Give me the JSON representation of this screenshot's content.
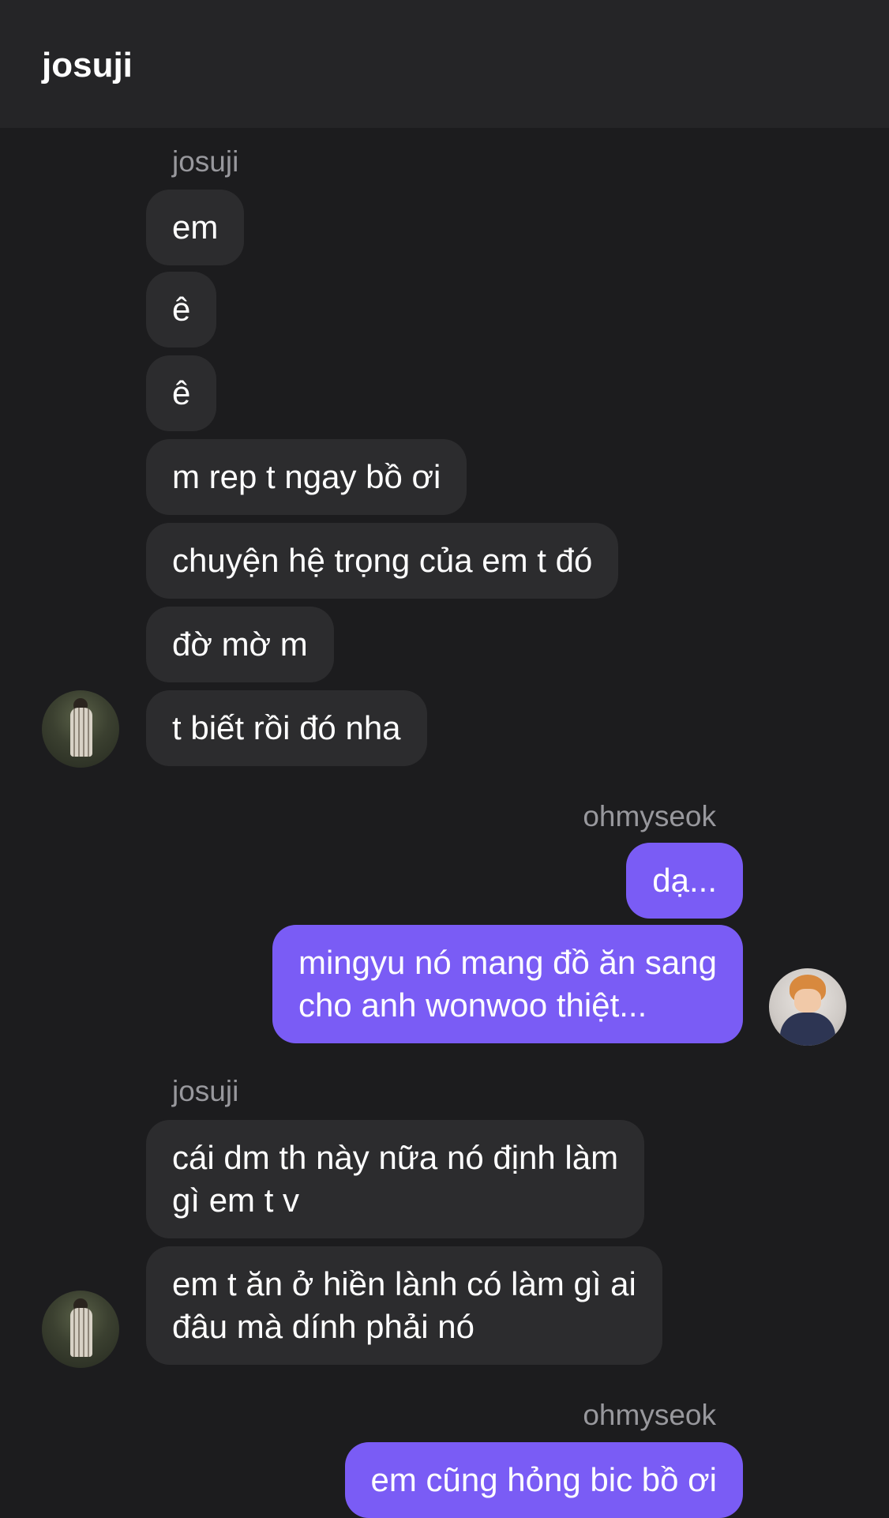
{
  "header": {
    "title": "josuji"
  },
  "messages": {
    "group1_sender": "josuji",
    "m1": "em",
    "m2": "ê",
    "m3": "ê",
    "m4": "m rep t ngay bồ ơi",
    "m5": "chuyện hệ trọng của em t đó",
    "m6": "đờ mờ m",
    "m7": "t biết rồi đó nha",
    "group2_sender": "ohmyseok",
    "m8": "dạ...",
    "m9": "mingyu nó mang đồ ăn sang\ncho anh wonwoo thiệt...",
    "group3_sender": "josuji",
    "m10": "cái dm th này nữa nó định làm\ngì em t v",
    "m11": "em t ăn ở hiền lành có làm gì ai\nđâu mà dính phải nó",
    "group4_sender": "ohmyseok",
    "m12": "em cũng hỏng bic bồ ơi"
  },
  "colors": {
    "background": "#1c1c1e",
    "header": "#252527",
    "incoming_bubble": "#2c2c2e",
    "outgoing_bubble": "#7a5cf5",
    "sender_label": "#98989d"
  }
}
